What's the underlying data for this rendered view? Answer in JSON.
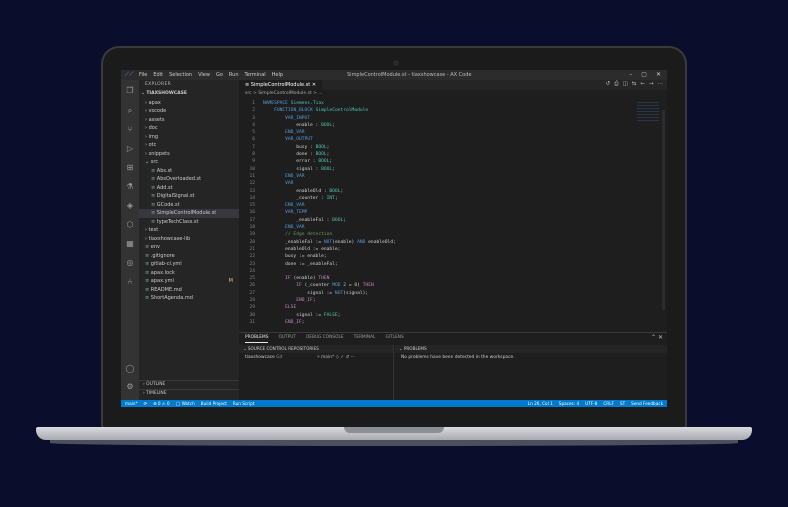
{
  "window": {
    "title": "SimpleControlModule.st - tiaxshowcase - AX Code",
    "menu": [
      "File",
      "Edit",
      "Selection",
      "View",
      "Go",
      "Run",
      "Terminal",
      "Help"
    ]
  },
  "sidebar": {
    "header": "EXPLORER",
    "root": "TIAXSHOWCASE",
    "items": [
      {
        "label": "apax",
        "indent": 1,
        "type": "folder"
      },
      {
        "label": "vscode",
        "indent": 1,
        "type": "folder"
      },
      {
        "label": "assets",
        "indent": 1,
        "type": "folder"
      },
      {
        "label": "doc",
        "indent": 1,
        "type": "folder"
      },
      {
        "label": "img",
        "indent": 1,
        "type": "folder"
      },
      {
        "label": "otc",
        "indent": 1,
        "type": "folder"
      },
      {
        "label": "snippets",
        "indent": 1,
        "type": "folder"
      },
      {
        "label": "src",
        "indent": 1,
        "type": "folder-open"
      },
      {
        "label": "Abs.st",
        "indent": 2,
        "type": "file"
      },
      {
        "label": "AbsOverloaded.st",
        "indent": 2,
        "type": "file"
      },
      {
        "label": "Add.st",
        "indent": 2,
        "type": "file"
      },
      {
        "label": "DigitalSignal.st",
        "indent": 2,
        "type": "file"
      },
      {
        "label": "GCode.st",
        "indent": 2,
        "type": "file"
      },
      {
        "label": "SimpleControlModule.st",
        "indent": 2,
        "type": "file",
        "selected": true
      },
      {
        "label": "typeTechClass.st",
        "indent": 2,
        "type": "file"
      },
      {
        "label": "test",
        "indent": 1,
        "type": "folder"
      },
      {
        "label": "tiaxshowcase-lib",
        "indent": 1,
        "type": "folder"
      },
      {
        "label": "env",
        "indent": 1,
        "type": "file"
      },
      {
        "label": ".gitignore",
        "indent": 1,
        "type": "file"
      },
      {
        "label": "gitlab-ci.yml",
        "indent": 1,
        "type": "file"
      },
      {
        "label": "apax.lock",
        "indent": 1,
        "type": "file"
      },
      {
        "label": "apax.yml",
        "indent": 1,
        "type": "file",
        "badge": "M"
      },
      {
        "label": "README.md",
        "indent": 1,
        "type": "file"
      },
      {
        "label": "ShortAgenda.md",
        "indent": 1,
        "type": "file"
      }
    ],
    "outline_label": "OUTLINE",
    "timeline_label": "TIMELINE"
  },
  "editor": {
    "tab_label": "SimpleControlModule.st",
    "breadcrumb": "src > SimpleControlModule.st > ...",
    "lines": [
      "NAMESPACE Siemens.Tiax",
      "    FUNCTION_BLOCK SimpleControlModule",
      "        VAR_INPUT",
      "            enable : BOOL;",
      "        END_VAR",
      "        VAR_OUTPUT",
      "            busy : BOOL;",
      "            done : BOOL;",
      "            error : BOOL;",
      "            signal : BOOL;",
      "        END_VAR",
      "        VAR",
      "            enableOld : BOOL;",
      "            _counter : INT;",
      "        END_VAR",
      "        VAR_TEMP",
      "            _enableFal : BOOL;",
      "        END_VAR",
      "        // Edge detection",
      "        _enableFal := NOT(enable) AND enableOld;",
      "        enableOld := enable;",
      "        busy := enable;",
      "        done := _enableFal;",
      "",
      "        IF (enable) THEN",
      "            IF (_counter MOD 2 = 0) THEN",
      "                signal := NOT(signal);",
      "            END_IF;",
      "        ELSE",
      "            signal := FALSE;",
      "        END_IF;"
    ]
  },
  "panel": {
    "tabs": [
      "PROBLEMS",
      "OUTPUT",
      "DEBUG CONSOLE",
      "TERMINAL",
      "GITLENS"
    ],
    "scm_header": "SOURCE CONTROL REPOSITORIES",
    "scm_repo": "tiaxshowcase",
    "scm_repo_tag": "Git",
    "scm_branch": "main*",
    "problems_header": "PROBLEMS",
    "problems_message": "No problems have been detected in the workspace."
  },
  "statusbar": {
    "left": [
      "main*",
      "⟳",
      "⊗ 0 ⚠ 0",
      "◯ Watch",
      "Build Project",
      "Run Script"
    ],
    "right": [
      "Ln 26, Col 1",
      "Spaces: 4",
      "UTF-8",
      "CRLF",
      "ST",
      "Send Feedback"
    ]
  },
  "colors": {
    "accent": "#007acc",
    "background": "#0b0d2c"
  }
}
